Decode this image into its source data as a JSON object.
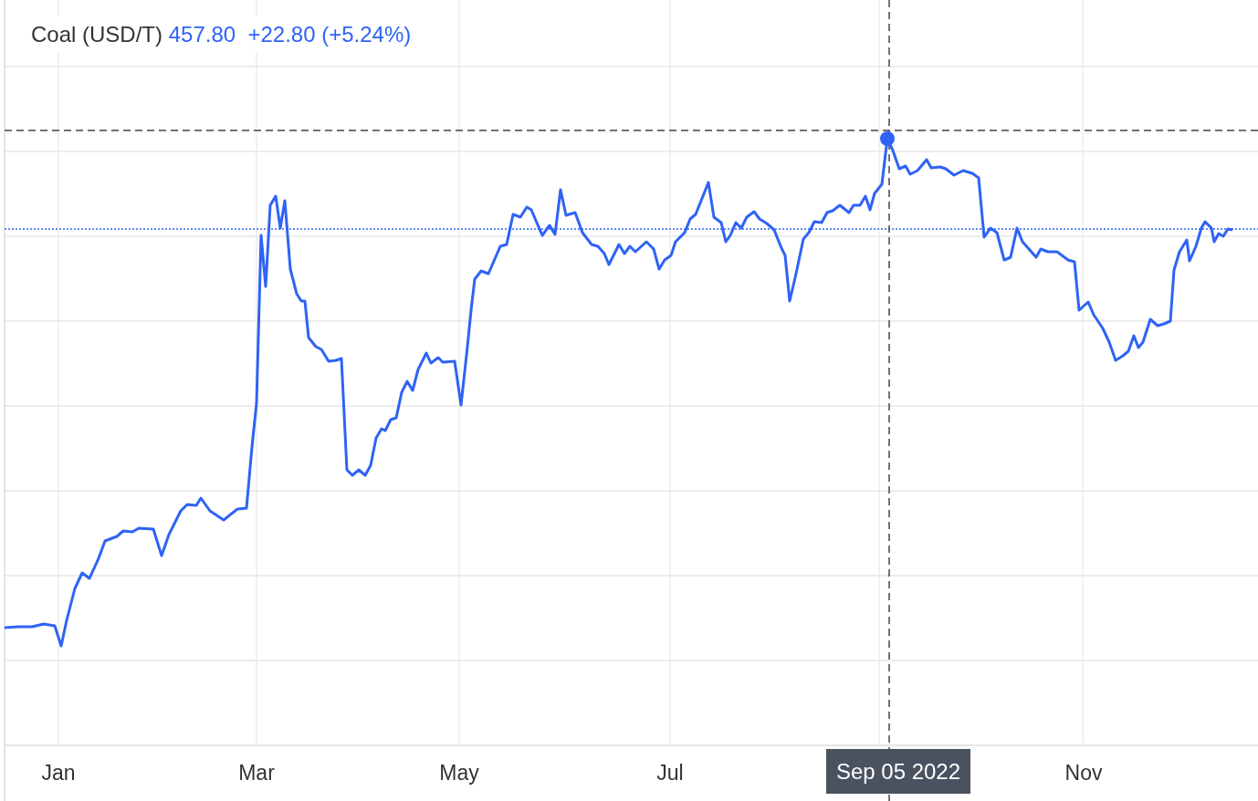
{
  "header": {
    "symbol": "Coal (USD/T)",
    "price": "457.80",
    "change": "+22.80 (+5.24%)"
  },
  "x_axis_labels": [
    "Jan",
    "Mar",
    "May",
    "Jul",
    "Nov"
  ],
  "crosshair": {
    "date_label": "Sep 05 2022"
  }
}
